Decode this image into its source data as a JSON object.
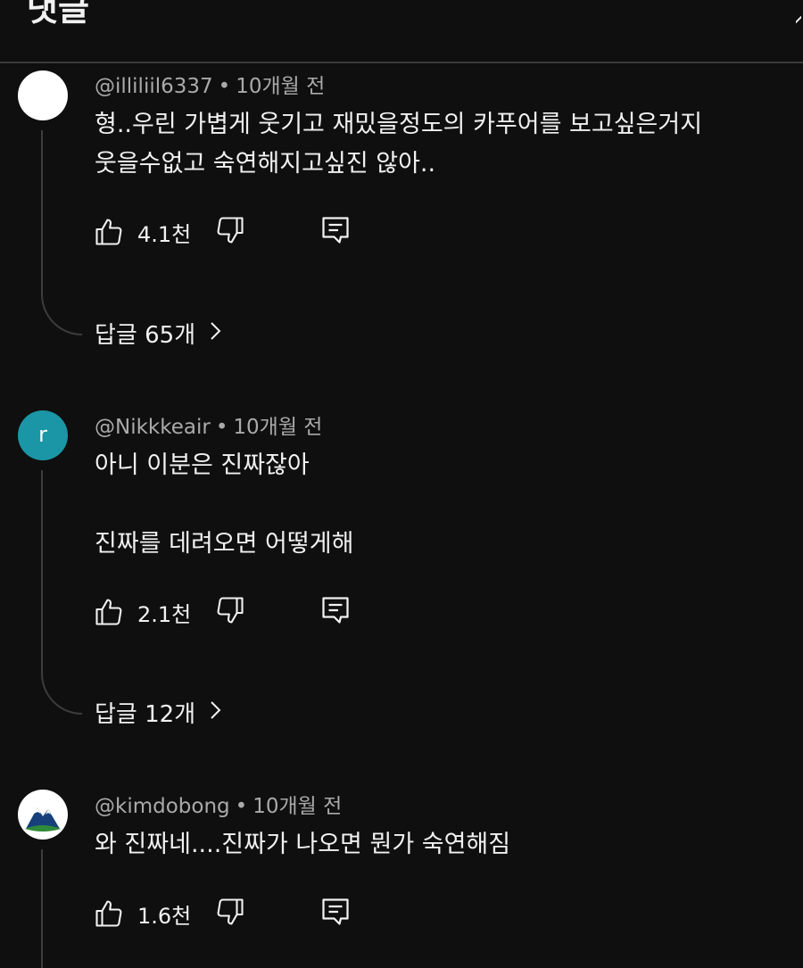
{
  "header": {
    "title": "댓글"
  },
  "comments": [
    {
      "author": "@illiliil6337",
      "time": "10개월 전",
      "text": "형..우린 가볍게 웃기고 재밌을정도의 카푸어를 보고싶은거지\n웃을수없고 숙연해지고싶진 않아..",
      "likes": "4.1천",
      "replies": "답글 65개"
    },
    {
      "author": "@Nikkkeair",
      "avatar_letter": "r",
      "time": "10개월 전",
      "text": "아니 이분은 진짜잖아\n\n진짜를 데려오면 어떻게해",
      "likes": "2.1천",
      "replies": "답글 12개"
    },
    {
      "author": "@kimdobong",
      "time": "10개월 전",
      "text": "와 진짜네....진짜가 나오면 뭔가 숙연해짐",
      "likes": "1.6천"
    }
  ],
  "icons": {
    "like": "thumbs-up-icon",
    "dislike": "thumbs-down-icon",
    "reply": "comment-icon",
    "expand": "chevron-right-icon",
    "close": "close-icon"
  },
  "colors": {
    "background": "#0f0f0f",
    "text": "#f1f1f1",
    "meta": "#aaaaaa",
    "teal_avatar": "#1a96a6"
  }
}
